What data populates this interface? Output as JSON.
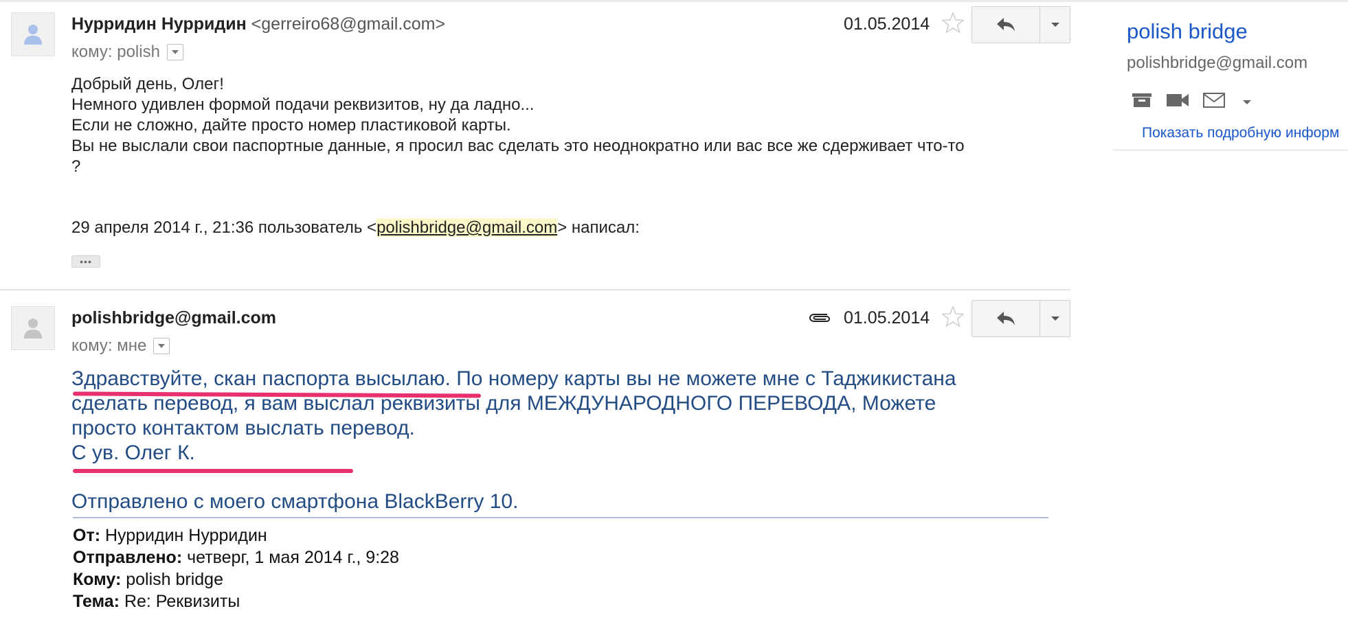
{
  "message1": {
    "sender_name": "Нурридин Нурридин",
    "sender_email": "<gerreiro68@gmail.com>",
    "to_line": "кому: polish",
    "date": "01.05.2014",
    "body_lines": [
      "Добрый день, Олег!",
      "Немного удивлен формой подачи реквизитов, ну да ладно...",
      "Если не сложно, дайте просто номер пластиковой карты.",
      "Вы не выслали свои паспортные  данные, я просил вас сделать это неоднократно или вас все же сдерживает что-то",
      "?"
    ],
    "quote_prefix": "29 апреля 2014 г., 21:36 пользователь <",
    "quote_email": "polishbridge@gmail.com",
    "quote_suffix": "> написал:",
    "ellipsis": "•••"
  },
  "message2": {
    "sender_name": "polishbridge@gmail.com",
    "to_line": "кому: мне",
    "date": "01.05.2014",
    "body_lines": [
      "Здравствуйте, скан паспорта высылаю. По номеру карты вы не можете мне с Таджикистана",
      "сделать перевод, я вам выслал реквизиты для МЕЖДУНАРОДНОГО ПЕРЕВОДА, Можете",
      "просто контактом выслать перевод.",
      "С ув. Олег К."
    ],
    "sent_from": "Отправлено с моего смартфона BlackBerry 10.",
    "headers": [
      {
        "label": "От:",
        "value": " Нурридин Нурридин"
      },
      {
        "label": "Отправлено:",
        "value": " четверг, 1 мая 2014 г., 9:28"
      },
      {
        "label": "Кому:",
        "value": " polish bridge"
      },
      {
        "label": "Тема:",
        "value": " Re: Реквизиты"
      }
    ]
  },
  "sidebar": {
    "name": "polish bridge",
    "email": "polishbridge@gmail.com",
    "icons": [
      "archive-icon",
      "video-icon",
      "mail-icon",
      "dropdown-arrow-icon"
    ],
    "details_link": "Показать подробную информ"
  },
  "colors": {
    "link_blue": "#1a57c9",
    "body_blue": "#234c84",
    "highlight_red": "#e8306c",
    "quote_highlight": "#fbf9c9"
  }
}
